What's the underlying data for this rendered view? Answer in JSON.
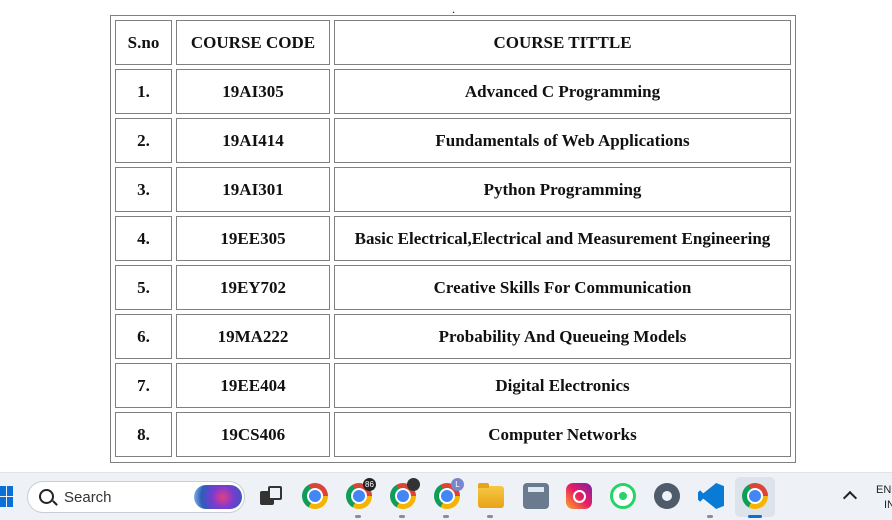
{
  "page": {
    "dot": "."
  },
  "table": {
    "headers": [
      "S.no",
      "COURSE CODE",
      "COURSE TITTLE"
    ],
    "rows": [
      [
        "1.",
        "19AI305",
        "Advanced C Programming"
      ],
      [
        "2.",
        "19AI414",
        "Fundamentals of Web Applications"
      ],
      [
        "3.",
        "19AI301",
        "Python Programming"
      ],
      [
        "4.",
        "19EE305",
        "Basic Electrical,Electrical and Measurement Engineering"
      ],
      [
        "5.",
        "19EY702",
        "Creative Skills For Communication"
      ],
      [
        "6.",
        "19MA222",
        "Probability And Queueing Models"
      ],
      [
        "7.",
        "19EE404",
        "Digital Electronics"
      ],
      [
        "8.",
        "19CS406",
        "Computer Networks"
      ]
    ]
  },
  "taskbar": {
    "search_label": "Search",
    "badges": {
      "chrome2": "86",
      "chrome4": "L"
    },
    "lang_line1": "EN",
    "lang_line2": "IN"
  }
}
